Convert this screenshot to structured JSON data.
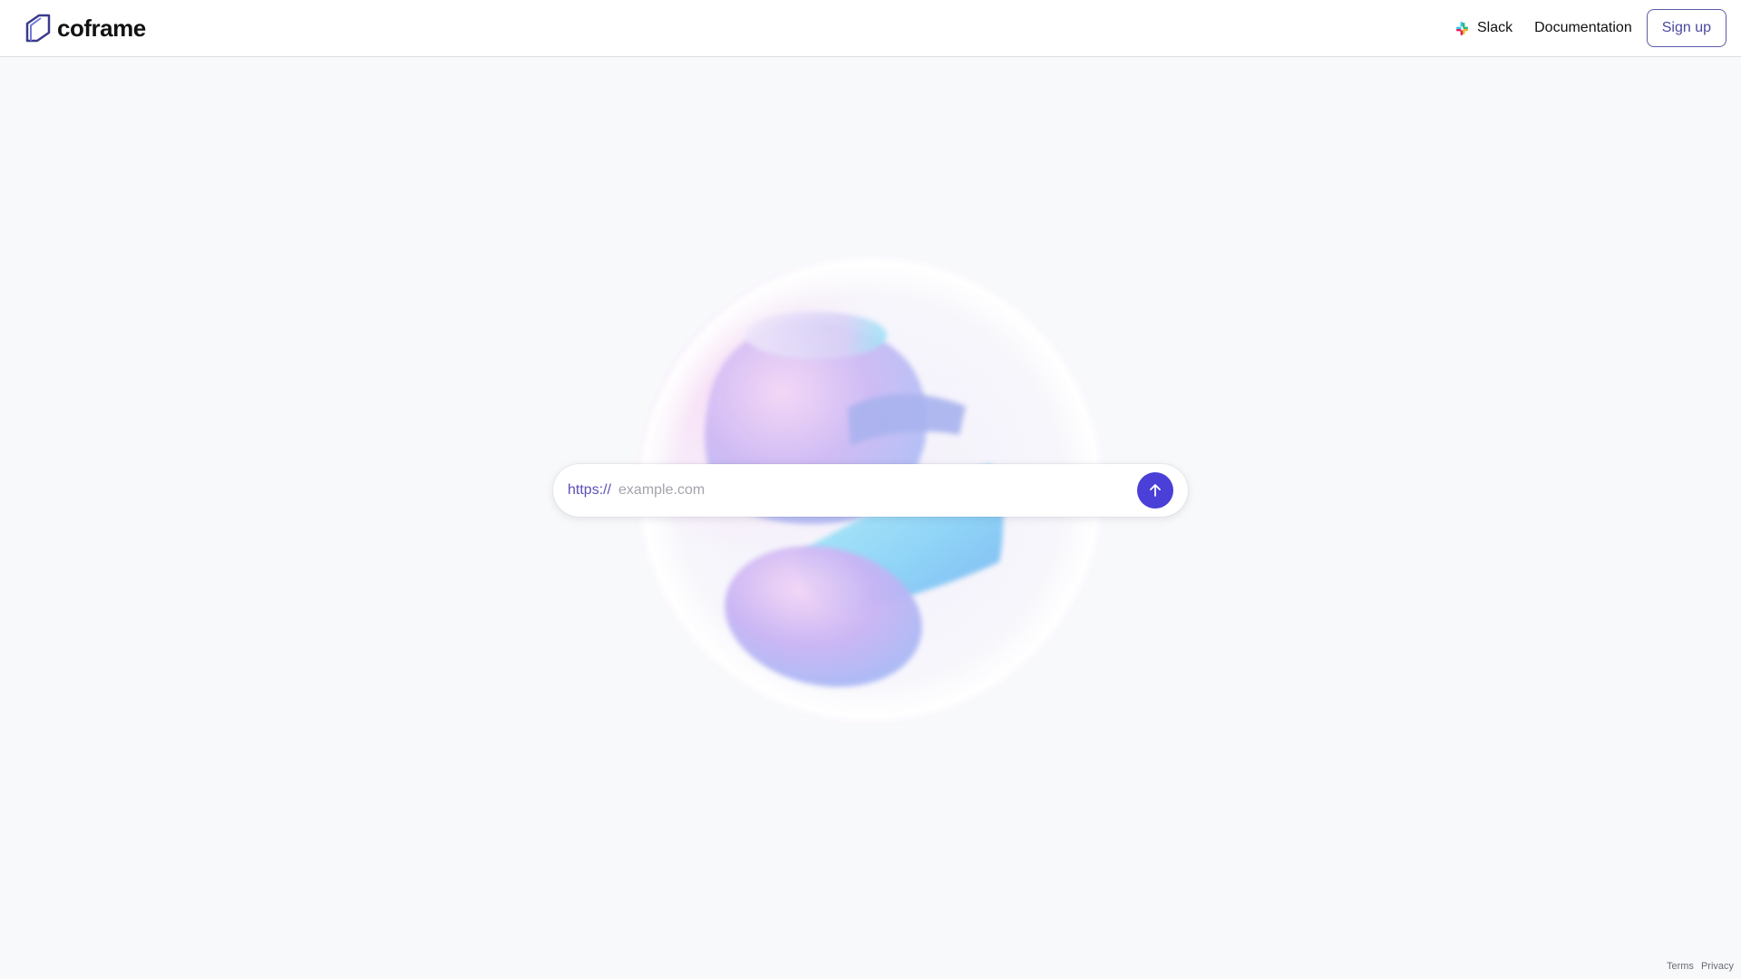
{
  "brand": {
    "name": "coframe",
    "logo_icon": "coframe-logo-icon"
  },
  "nav": {
    "slack_label": "Slack",
    "slack_icon": "slack-icon",
    "docs_label": "Documentation",
    "signup_label": "Sign up"
  },
  "url_bar": {
    "prefix": "https://",
    "placeholder": "example.com",
    "submit_icon": "arrow-up-icon"
  },
  "footer": {
    "terms": "Terms",
    "privacy": "Privacy"
  },
  "colors": {
    "accent": "#4a3fd6",
    "prefix_text": "#5b4fb8",
    "signup_border": "#5c5aa8",
    "page_background": "#f8f9fb"
  }
}
